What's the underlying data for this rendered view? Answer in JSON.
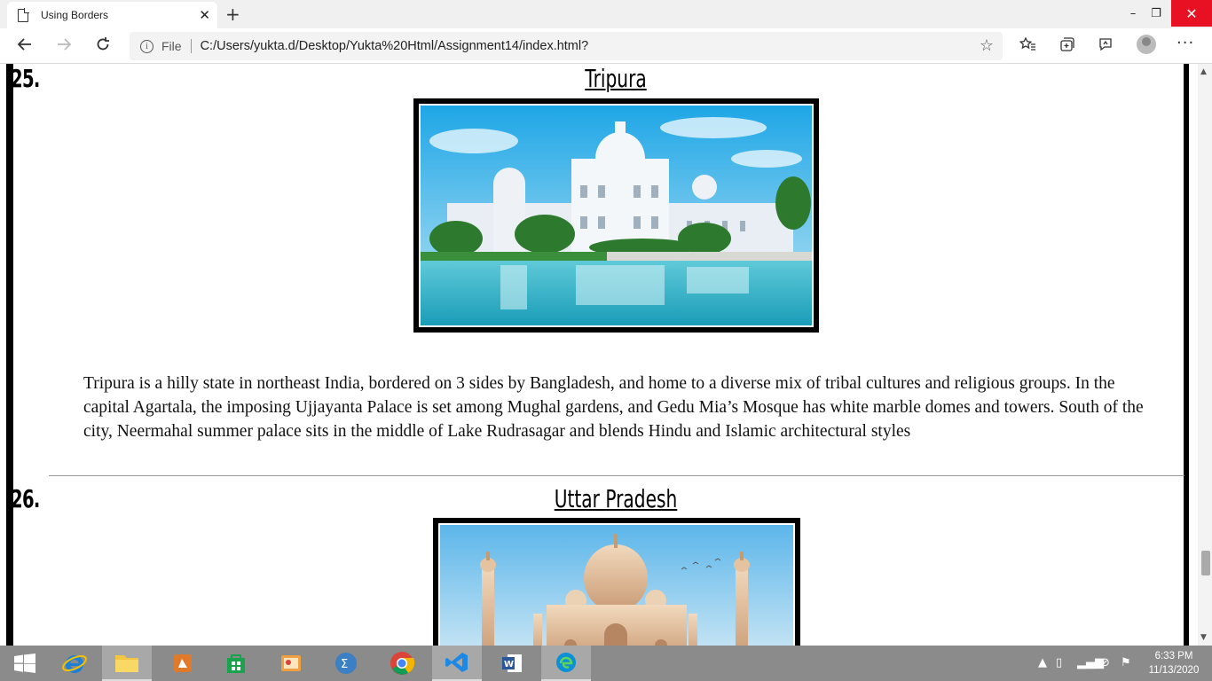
{
  "browser": {
    "tab_title": "Using Borders",
    "tab_close": "✕",
    "new_tab": "+",
    "address_scheme": "File",
    "address_url": "C:/Users/yukta.d/Desktop/Yukta%20Html/Assignment14/index.html?",
    "window_min": "–",
    "window_max": "❐",
    "window_close": "✕"
  },
  "page": {
    "sections": [
      {
        "number": "25.",
        "state": "Tripura",
        "description": "Tripura is a hilly state in northeast India, bordered on 3 sides by Bangladesh, and home to a diverse mix of tribal cultures and religious groups. In the capital Agartala, the imposing Ujjayanta Palace is set among Mughal gardens, and Gedu Mia’s Mosque has white marble domes and towers. South of the city, Neermahal summer palace sits in the middle of Lake Rudrasagar and blends Hindu and Islamic architectural styles"
      },
      {
        "number": "26.",
        "state": "Uttar Pradesh"
      }
    ]
  },
  "taskbar": {
    "time": "6:33 PM",
    "date": "11/13/2020"
  }
}
